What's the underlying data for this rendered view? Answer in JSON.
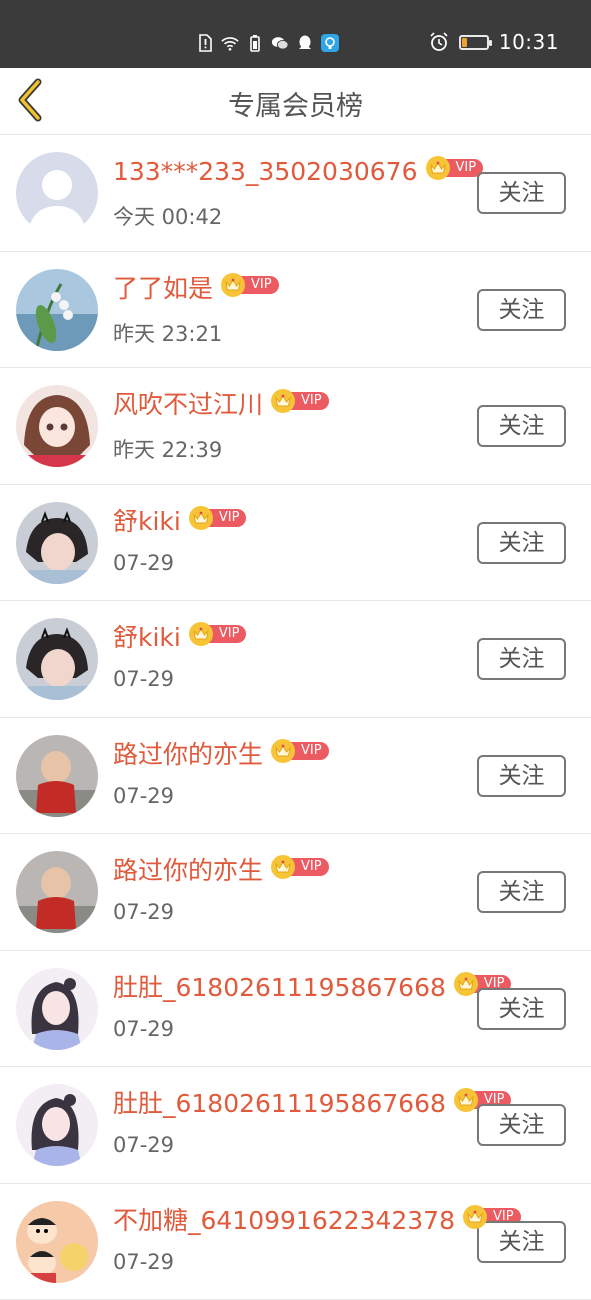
{
  "status_bar": {
    "time": "10:31",
    "icons": [
      "sim-alert-icon",
      "wifi-icon",
      "battery-saver-icon",
      "wechat-icon",
      "qq-icon",
      "notification-app-icon"
    ],
    "right_icons": [
      "alarm-icon",
      "battery-icon"
    ],
    "battery_level": 0.2,
    "battery_color": "#f0a030"
  },
  "header": {
    "title": "专属会员榜",
    "back_icon": "chevron-left-icon",
    "accent": "#f2c12e"
  },
  "members": [
    {
      "name": "133***233_3502030676",
      "time": "今天 00:42",
      "vip": "VIP",
      "follow": "关注",
      "avatar": "default-person"
    },
    {
      "name": "了了如是",
      "time": "昨天 23:21",
      "vip": "VIP",
      "follow": "关注",
      "avatar": "lily-flowers"
    },
    {
      "name": "风吹不过江川",
      "time": "昨天 22:39",
      "vip": "VIP",
      "follow": "关注",
      "avatar": "anime-girl"
    },
    {
      "name": "舒kiki",
      "time": "07-29",
      "vip": "VIP",
      "follow": "关注",
      "avatar": "girl-photo"
    },
    {
      "name": "舒kiki",
      "time": "07-29",
      "vip": "VIP",
      "follow": "关注",
      "avatar": "girl-photo"
    },
    {
      "name": "路过你的亦生",
      "time": "07-29",
      "vip": "VIP",
      "follow": "关注",
      "avatar": "child-photo"
    },
    {
      "name": "路过你的亦生",
      "time": "07-29",
      "vip": "VIP",
      "follow": "关注",
      "avatar": "child-photo"
    },
    {
      "name": "肚肚_61802611195867668",
      "time": "07-29",
      "vip": "VIP",
      "follow": "关注",
      "avatar": "anime-woman"
    },
    {
      "name": "肚肚_61802611195867668",
      "time": "07-29",
      "vip": "VIP",
      "follow": "关注",
      "avatar": "anime-woman"
    },
    {
      "name": "不加糖_6410991622342378",
      "time": "07-29",
      "vip": "VIP",
      "follow": "关注",
      "avatar": "cartoon-kids"
    }
  ],
  "colors": {
    "name": "#e05a3c",
    "vip_tag": "#ec5a62",
    "crown": "#f7c437",
    "status_bar_bg": "#3b3b3b"
  }
}
